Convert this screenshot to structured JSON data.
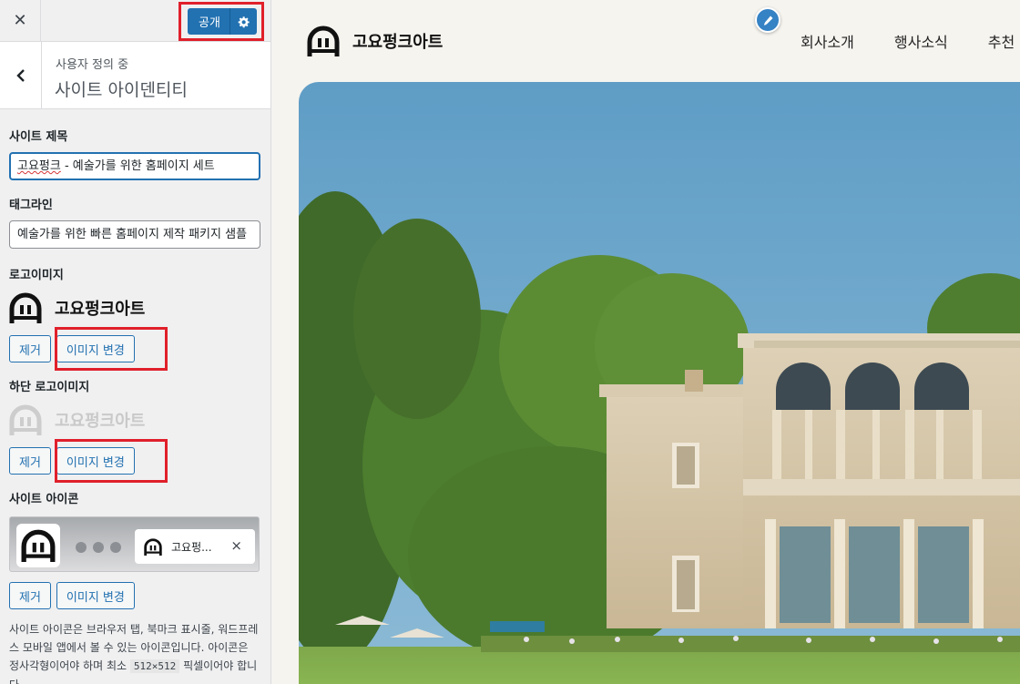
{
  "sidebar": {
    "close_icon": "close-icon",
    "publish_label": "공개",
    "section_breadcrumb": "사용자 정의 중",
    "section_title": "사이트 아이덴티티",
    "site_title": {
      "label": "사이트 제목",
      "value_spell": "고요펑크",
      "value_rest": " - 예술가를 위한 홈페이지 세트"
    },
    "tagline": {
      "label": "태그라인",
      "value": "예술가를 위한 빠른 홈페이지 제작 패키지 샘플"
    },
    "logo": {
      "label": "로고이미지",
      "text": "고요펑크아트",
      "remove": "제거",
      "change": "이미지 변경"
    },
    "footer_logo": {
      "label": "하단 로고이미지",
      "text": "고요펑크아트",
      "remove": "제거",
      "change": "이미지 변경"
    },
    "site_icon": {
      "label": "사이트 아이콘",
      "tab_text": "고요펑...",
      "tab_close": "×",
      "remove": "제거",
      "change": "이미지 변경",
      "desc_before": "사이트 아이콘은 브라우저 탭, 북마크 표시줄, 워드프레스 모바일 앱에서 볼 수 있는 아이콘입니다. 아이콘은 정사각형이어야 하며 최소 ",
      "desc_code": "512×512",
      "desc_after": " 픽셀이어야 합니다."
    }
  },
  "preview": {
    "brand": "고요펑크아트",
    "nav": [
      "회사소개",
      "행사소식",
      "추천"
    ]
  },
  "colors": {
    "accent": "#2271b1",
    "highlight": "#e0202b",
    "sidebar_bg": "#f0f0f1",
    "preview_bg": "#f6f4ef"
  }
}
